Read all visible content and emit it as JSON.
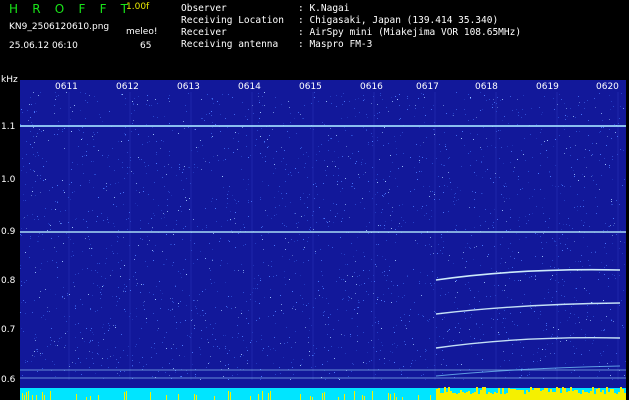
{
  "header": {
    "app_title": "H R O F F T",
    "app_version": "1.00f",
    "file_name": "KN9_2506120610.png",
    "meleo_label": "meleo!",
    "datetime": "25.06.12 06:10",
    "meleo_value": "65",
    "info": [
      {
        "key": "Observer",
        "value": ": K.Nagai"
      },
      {
        "key": "Receiving Location",
        "value": ": Chigasaki, Japan (139.414 35.340)"
      },
      {
        "key": "Receiver",
        "value": ": AirSpy mini (Miakejima VOR 108.65MHz)"
      },
      {
        "key": "Receiving antenna",
        "value": ": Maspro FM-3"
      }
    ]
  },
  "spectrogram": {
    "unit_label": "kHz",
    "time_ticks": [
      "0611",
      "0612",
      "0613",
      "0614",
      "0615",
      "0616",
      "0617",
      "0618",
      "0619",
      "0620"
    ],
    "freq_ticks": [
      "1.1",
      "1.0",
      "0.9",
      "0.8",
      "0.7",
      "0.6"
    ],
    "colors": {
      "background": "#12189a",
      "noise": "#4a78ff",
      "carrier": "#9fdcff",
      "trace": "#d7f5ff",
      "bar_cyan": "#00e5ff",
      "bar_yellow": "#f5f000"
    }
  }
}
